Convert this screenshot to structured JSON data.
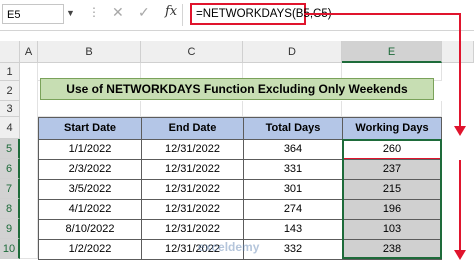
{
  "formula_bar": {
    "name_box": "E5",
    "formula": "=NETWORKDAYS(B5,C5)",
    "fx_label": "fx"
  },
  "columns": [
    "A",
    "B",
    "C",
    "D",
    "E"
  ],
  "rows": [
    "1",
    "2",
    "3",
    "4",
    "5",
    "6",
    "7",
    "8",
    "9",
    "10"
  ],
  "title": "Use of NETWORKDAYS Function Excluding Only Weekends",
  "table": {
    "headers": [
      "Start Date",
      "End Date",
      "Total Days",
      "Working Days"
    ],
    "rows": [
      [
        "1/1/2022",
        "12/31/2022",
        "364",
        "260"
      ],
      [
        "2/3/2022",
        "12/31/2022",
        "331",
        "237"
      ],
      [
        "3/5/2022",
        "12/31/2022",
        "301",
        "215"
      ],
      [
        "4/1/2022",
        "12/31/2022",
        "274",
        "196"
      ],
      [
        "8/10/2022",
        "12/31/2022",
        "143",
        "103"
      ],
      [
        "1/2/2022",
        "12/31/2022",
        "332",
        "238"
      ]
    ]
  },
  "watermark": "exceldemy",
  "colors": {
    "accent": "#e0142d",
    "selection": "#1e6b3a",
    "title_bg": "#c7deb3",
    "header_bg": "#b4c6e7"
  }
}
